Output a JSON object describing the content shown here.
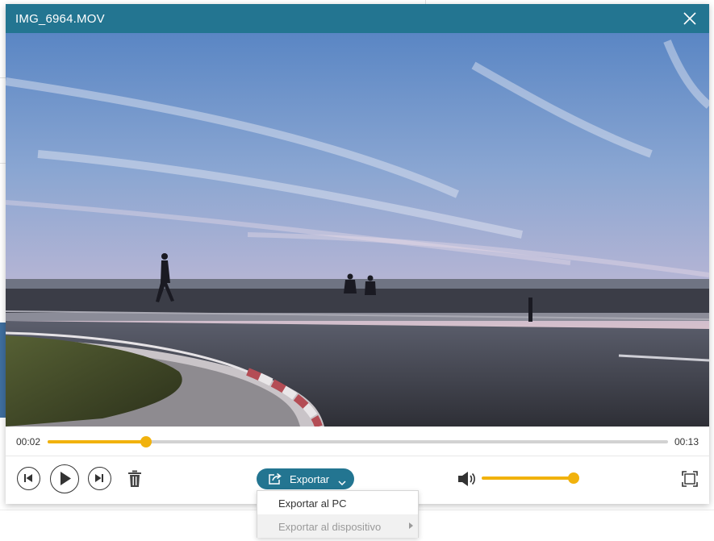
{
  "window": {
    "title": "IMG_6964.MOV"
  },
  "player": {
    "current_time": "00:02",
    "duration": "00:13",
    "progress_fraction": 0.158,
    "volume_fraction": 1.0
  },
  "export": {
    "label": "Exportar",
    "menu": [
      {
        "label": "Exportar al PC",
        "enabled": true
      },
      {
        "label": "Exportar al dispositivo",
        "enabled": false,
        "has_submenu": true
      }
    ]
  },
  "icons": {
    "close": "close-icon",
    "previous": "previous-track-icon",
    "play": "play-icon",
    "next": "next-track-icon",
    "delete": "trash-icon",
    "export": "export-icon",
    "dropdown": "chevron-down-icon",
    "volume": "speaker-icon",
    "fullscreen": "fullscreen-icon"
  },
  "colors": {
    "accent": "#237591",
    "progress": "#f1b20d",
    "track": "#d2d2d2"
  }
}
